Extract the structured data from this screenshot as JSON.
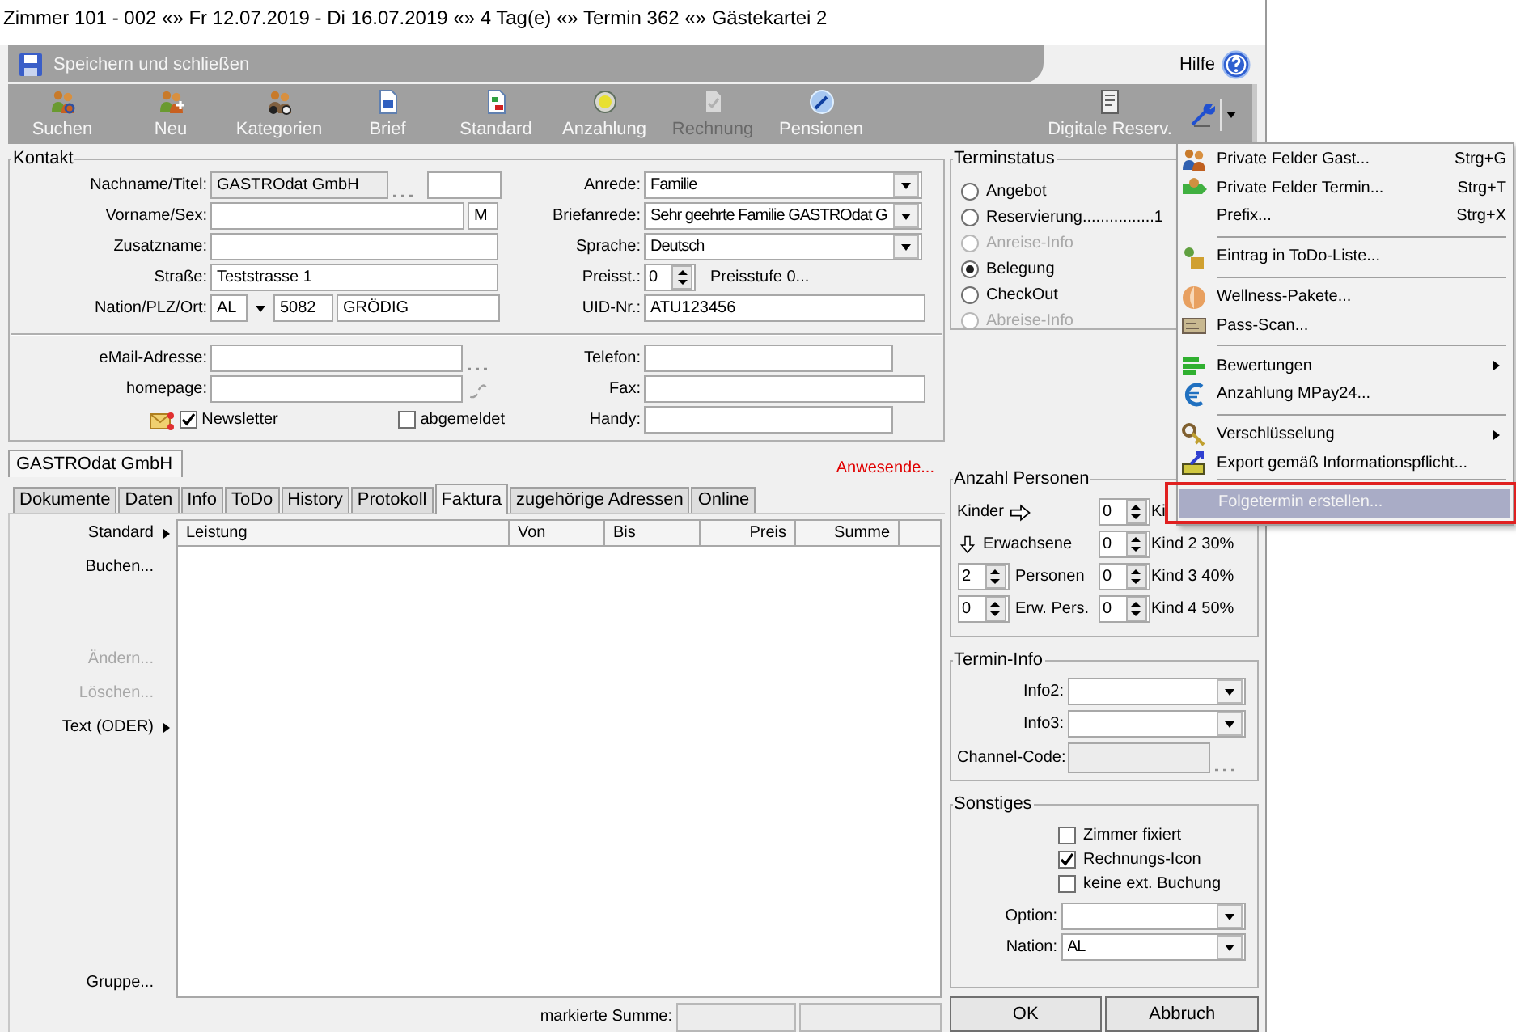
{
  "window": {
    "title": "Zimmer 101 - 002 «» Fr 12.07.2019 - Di 16.07.2019 «» 4 Tag(e) «» Termin 362 «» Gästekartei 2"
  },
  "save_bar": {
    "label": "Speichern und schließen",
    "help": "Hilfe"
  },
  "toolbar": [
    {
      "label": "Suchen",
      "disabled": false
    },
    {
      "label": "Neu",
      "disabled": false
    },
    {
      "label": "Kategorien",
      "disabled": false
    },
    {
      "label": "Brief",
      "disabled": false
    },
    {
      "label": "Standard",
      "disabled": false
    },
    {
      "label": "Anzahlung",
      "disabled": false
    },
    {
      "label": "Rechnung",
      "disabled": true
    },
    {
      "label": "Pensionen",
      "disabled": false
    },
    {
      "label": "Digitale Reserv.",
      "disabled": false
    }
  ],
  "kontakt": {
    "title": "Kontakt",
    "left": [
      {
        "label": "Nachname/Titel:",
        "value": "GASTROdat GmbH"
      },
      {
        "label": "Vorname/Sex:",
        "sex": "M"
      },
      {
        "label": "Zusatzname:"
      },
      {
        "label": "Straße:",
        "value": "Teststrasse 1"
      },
      {
        "label": "Nation/PLZ/Ort:",
        "nation": "AL",
        "plz": "5082",
        "ort": "GRÖDIG"
      }
    ],
    "right": [
      {
        "label": "Anrede:",
        "value": "Familie"
      },
      {
        "label": "Briefanrede:",
        "value": "Sehr geehrte Familie GASTROdat G"
      },
      {
        "label": "Sprache:",
        "value": "Deutsch"
      },
      {
        "label": "Preisst.:",
        "value": "0",
        "note": "Preisstufe 0..."
      },
      {
        "label": "UID-Nr.:",
        "value": "ATU123456"
      }
    ],
    "email_label": "eMail-Adresse:",
    "homepage_label": "homepage:",
    "telefon_label": "Telefon:",
    "fax_label": "Fax:",
    "handy_label": "Handy:",
    "newsletter": {
      "label": "Newsletter",
      "checked": true
    },
    "abgemeldet": {
      "label": "abgemeldet",
      "checked": false
    }
  },
  "person_tab": "GASTROdat GmbH",
  "anwesende": "Anwesende...",
  "tabs": [
    {
      "label": "Dokumente",
      "selected": false
    },
    {
      "label": "Daten",
      "selected": false
    },
    {
      "label": "Info",
      "selected": false
    },
    {
      "label": "ToDo",
      "selected": false
    },
    {
      "label": "History",
      "selected": false
    },
    {
      "label": "Protokoll",
      "selected": false
    },
    {
      "label": "Faktura",
      "selected": true
    },
    {
      "label": "zugehörige Adressen",
      "selected": false
    },
    {
      "label": "Online",
      "selected": false
    }
  ],
  "faktura": {
    "actions": [
      {
        "label": "Standard",
        "disabled": false,
        "submenu": true
      },
      {
        "label": "Buchen...",
        "disabled": false,
        "submenu": false
      },
      {
        "label": "Ändern...",
        "disabled": true,
        "submenu": false
      },
      {
        "label": "Löschen...",
        "disabled": true,
        "submenu": false
      },
      {
        "label": "Text (ODER)",
        "disabled": false,
        "submenu": true
      },
      {
        "label": "Gruppe...",
        "disabled": false,
        "submenu": false
      }
    ],
    "columns": [
      "Leistung",
      "Von",
      "Bis",
      "Preis",
      "Summe"
    ],
    "summe_label": "markierte Summe:"
  },
  "terminstatus": {
    "title": "Terminstatus",
    "options": [
      {
        "label": "Angebot",
        "selected": false,
        "disabled": false
      },
      {
        "label": "Reservierung................1",
        "selected": false,
        "disabled": false
      },
      {
        "label": "Anreise-Info",
        "selected": false,
        "disabled": true
      },
      {
        "label": "Belegung",
        "selected": true,
        "disabled": false
      },
      {
        "label": "CheckOut",
        "selected": false,
        "disabled": false
      },
      {
        "label": "Abreise-Info",
        "selected": false,
        "disabled": true
      }
    ]
  },
  "anzahl": {
    "title": "Anzahl Personen",
    "kinder": "Kinder",
    "erwachsene": "Erwachsene",
    "left": [
      {
        "value": "2",
        "label": "Personen"
      },
      {
        "value": "0",
        "label": "Erw. Pers."
      }
    ],
    "right": [
      {
        "value": "0",
        "label": "Ki"
      },
      {
        "value": "0",
        "label": "Kind 2 30%"
      },
      {
        "value": "0",
        "label": "Kind 3 40%"
      },
      {
        "value": "0",
        "label": "Kind 4 50%"
      }
    ]
  },
  "termin_info": {
    "title": "Termin-Info",
    "fields": [
      {
        "label": "Info2:",
        "kind": "combo"
      },
      {
        "label": "Info3:",
        "kind": "combo"
      },
      {
        "label": "Channel-Code:",
        "kind": "readonly"
      }
    ]
  },
  "sonstiges": {
    "title": "Sonstiges",
    "checks": [
      {
        "label": "Zimmer fixiert",
        "checked": false
      },
      {
        "label": "Rechnungs-Icon",
        "checked": true
      },
      {
        "label": "keine ext. Buchung",
        "checked": false
      }
    ],
    "option_label": "Option:",
    "nation_label": "Nation:",
    "nation_value": "AL"
  },
  "buttons": [
    "OK",
    "Abbruch"
  ],
  "menu": {
    "items": [
      {
        "label": "Private Felder Gast...",
        "shortcut": "Strg+G",
        "separator_before": false,
        "submenu": false,
        "selected": false,
        "annotated": false
      },
      {
        "label": "Private Felder Termin...",
        "shortcut": "Strg+T",
        "separator_before": false,
        "submenu": false,
        "selected": false,
        "annotated": false
      },
      {
        "label": "Prefix...",
        "shortcut": "Strg+X",
        "separator_before": false,
        "submenu": false,
        "selected": false,
        "annotated": false
      },
      {
        "label": "Eintrag in ToDo-Liste...",
        "separator_before": true,
        "submenu": false,
        "selected": false,
        "annotated": false
      },
      {
        "label": "Wellness-Pakete...",
        "separator_before": true,
        "submenu": false,
        "selected": false,
        "annotated": false
      },
      {
        "label": "Pass-Scan...",
        "separator_before": false,
        "submenu": false,
        "selected": false,
        "annotated": false
      },
      {
        "label": "Bewertungen",
        "separator_before": true,
        "submenu": true,
        "selected": false,
        "annotated": false
      },
      {
        "label": "Anzahlung MPay24...",
        "separator_before": false,
        "submenu": false,
        "selected": false,
        "annotated": false
      },
      {
        "label": "Verschlüsselung",
        "separator_before": true,
        "submenu": true,
        "selected": false,
        "annotated": false
      },
      {
        "label": "Export gemäß Informationspflicht...",
        "separator_before": false,
        "submenu": false,
        "selected": false,
        "annotated": false
      },
      {
        "label": "Folgetermin erstellen...",
        "separator_before": true,
        "submenu": false,
        "selected": true,
        "annotated": true
      }
    ]
  }
}
